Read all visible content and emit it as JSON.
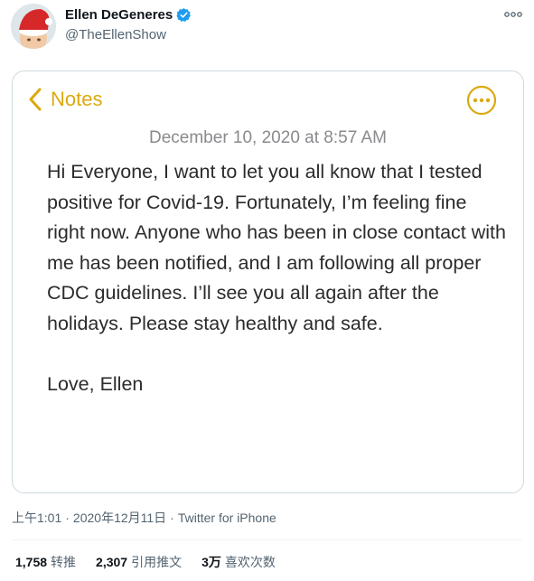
{
  "header": {
    "display_name": "Ellen DeGeneres",
    "handle": "@TheEllenShow",
    "avatar_icon": "profile-avatar-santa-hat",
    "verified_icon": "verified-badge-icon",
    "verified_color": "#1d9bf0",
    "more_icon": "more-horizontal-icon"
  },
  "note": {
    "back_label": "Notes",
    "accent_color": "#dba90f",
    "date": "December 10, 2020 at 8:57 AM",
    "body": "Hi Everyone, I want to let you all know that I tested positive for Covid-19. Fortunately, I’m feeling fine right now. Anyone who has been in close contact with me has been notified, and I am following all proper CDC guidelines. I’ll see you all again after the holidays. Please stay healthy and safe.",
    "sign_off": "Love, Ellen"
  },
  "meta": {
    "time": "上午1:01",
    "separator": "·",
    "date": "2020年12月11日",
    "source": "Twitter for iPhone"
  },
  "stats": [
    {
      "count": "1,758",
      "label": "转推"
    },
    {
      "count": "2,307",
      "label": "引用推文"
    },
    {
      "count": "3万",
      "label": "喜欢次数"
    }
  ]
}
